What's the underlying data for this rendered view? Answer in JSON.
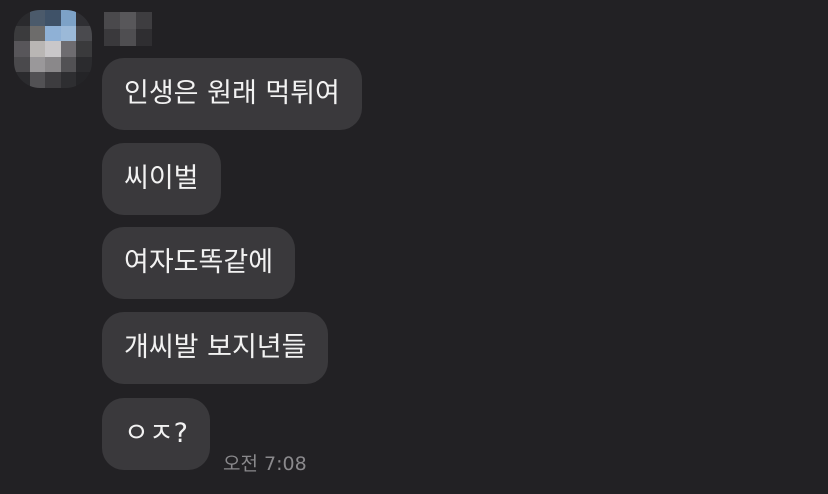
{
  "chat": {
    "sender_name": "",
    "messages": [
      {
        "text": "인생은 원래 먹튀여"
      },
      {
        "text": "씨이벌"
      },
      {
        "text": "여자도똑같에"
      },
      {
        "text": "개씨발 보지년들"
      },
      {
        "text": "ㅇㅈ?"
      }
    ],
    "last_timestamp": "오전 7:08"
  },
  "colors": {
    "background": "#222124",
    "bubble": "#3a393c",
    "text": "#f2f2f2",
    "timestamp": "#8a898c"
  }
}
